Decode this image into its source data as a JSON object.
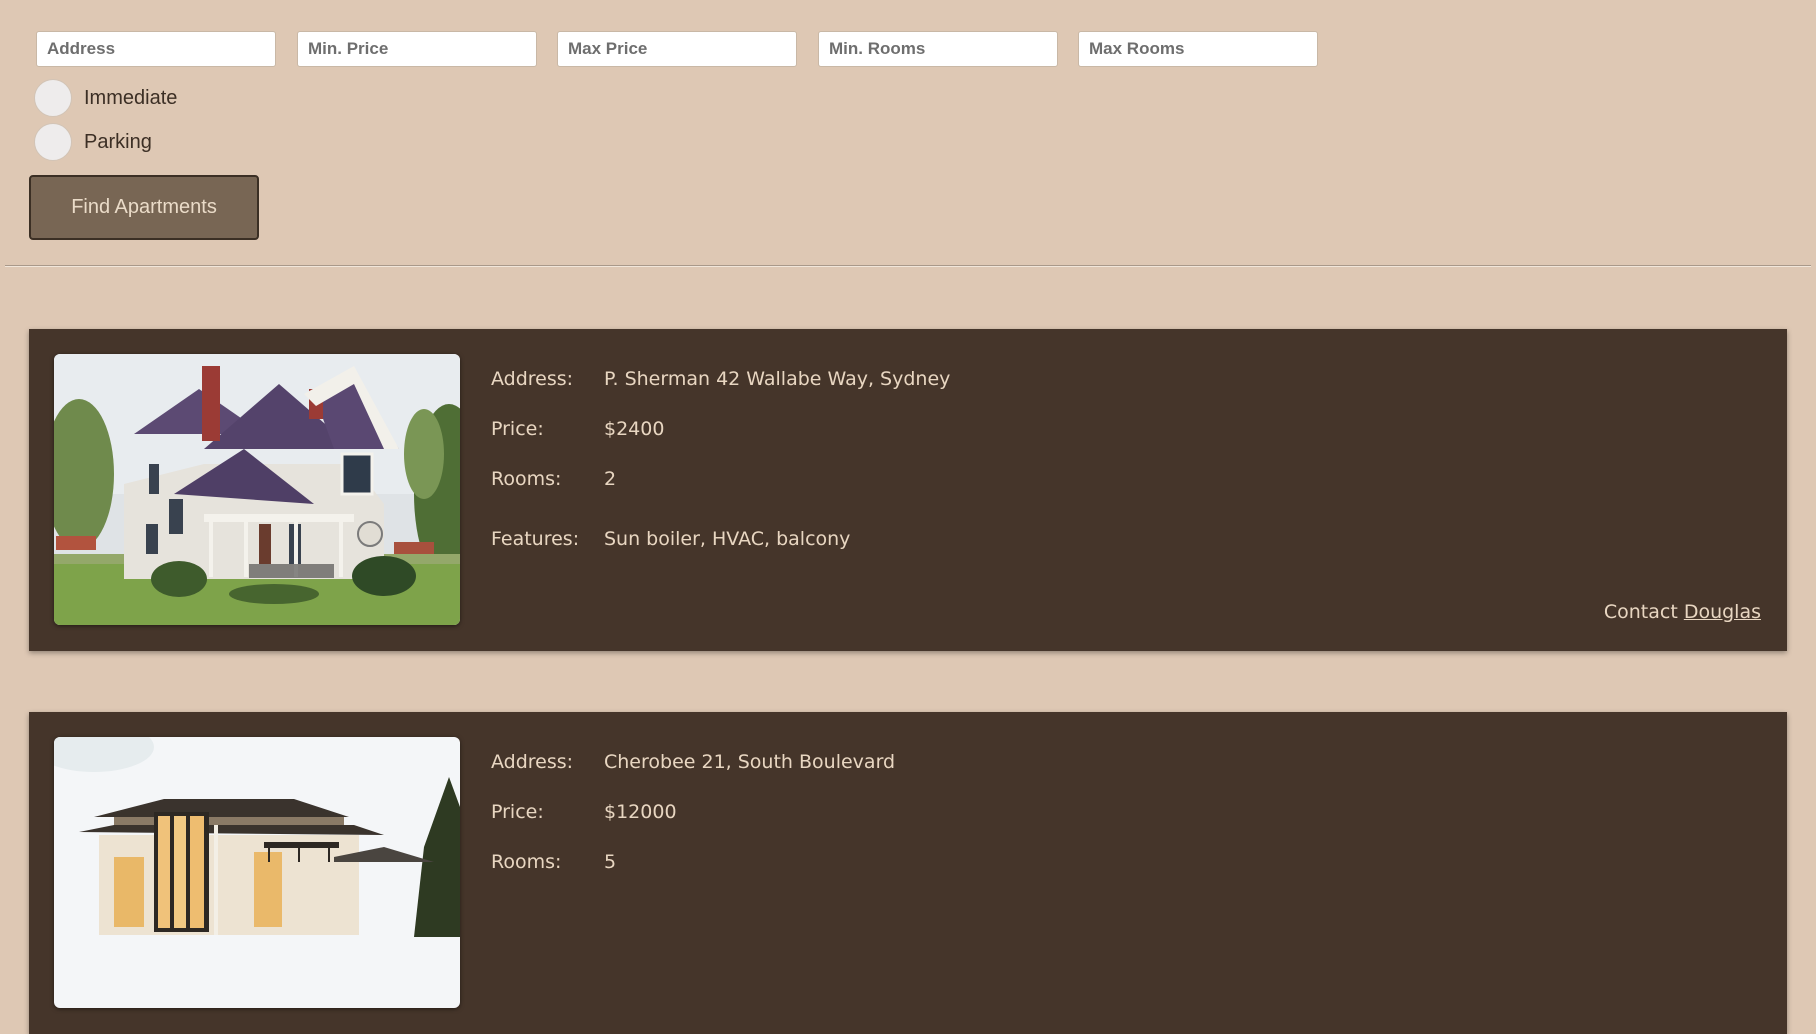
{
  "filters": {
    "address_placeholder": "Address",
    "min_price_placeholder": "Min. Price",
    "max_price_placeholder": "Max Price",
    "min_rooms_placeholder": "Min. Rooms",
    "max_rooms_placeholder": "Max Rooms",
    "immediate_label": "Immediate",
    "parking_label": "Parking",
    "find_button": "Find Apartments"
  },
  "listings": [
    {
      "address_label": "Address:",
      "address": "P. Sherman 42 Wallabe Way, Sydney",
      "price_label": "Price:",
      "price": "$2400",
      "rooms_label": "Rooms:",
      "rooms": "2",
      "features_label": "Features:",
      "features": "Sun boiler, HVAC, balcony",
      "contact_prefix": "Contact",
      "contact_name": "Douglas"
    },
    {
      "address_label": "Address:",
      "address": "Cherobee 21, South Boulevard",
      "price_label": "Price:",
      "price": "$12000",
      "rooms_label": "Rooms:",
      "rooms": "5"
    }
  ],
  "colors": {
    "page_background": "#dec8b4",
    "card_background": "#45352a",
    "button_background": "#786654",
    "card_text": "#e8d6c1"
  }
}
